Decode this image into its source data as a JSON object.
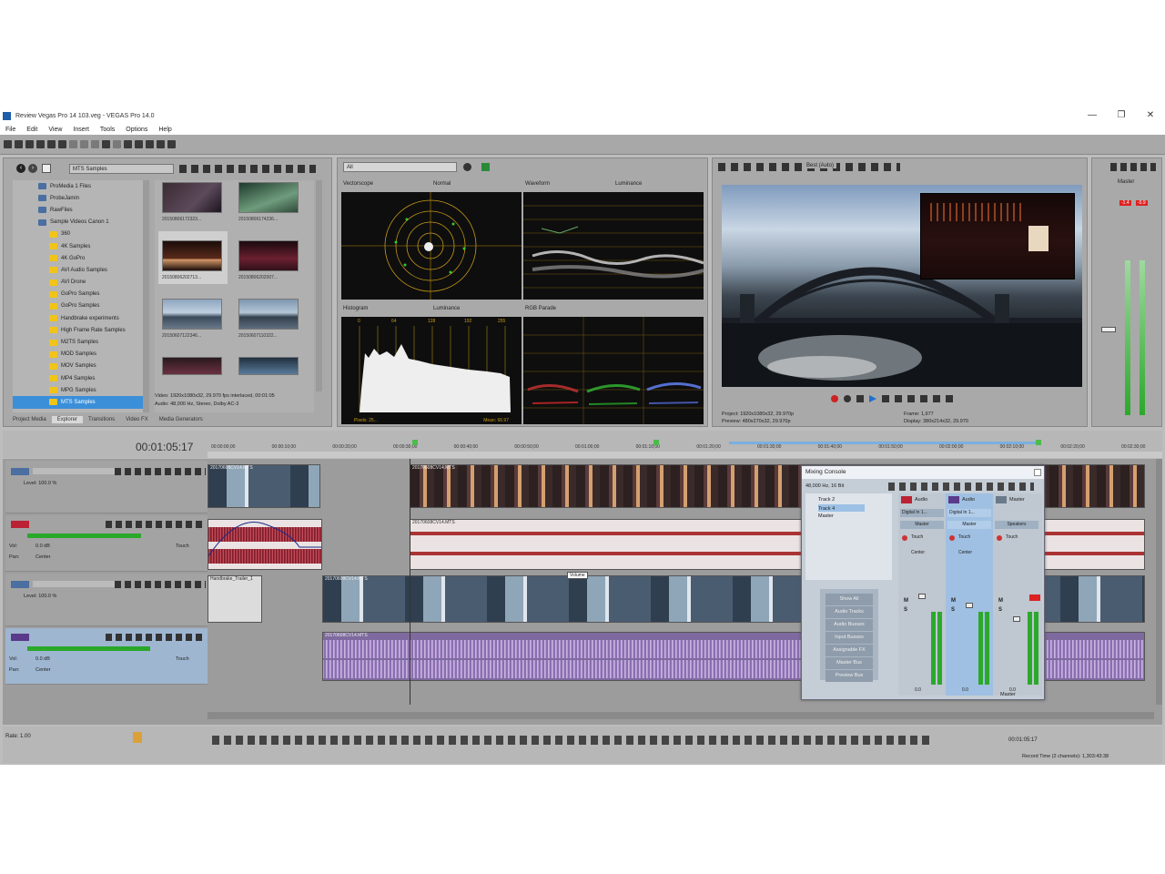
{
  "window": {
    "title": "Review Vegas Pro 14 103.veg - VEGAS Pro 14.0",
    "controls": [
      "—",
      "❐",
      "✕"
    ]
  },
  "menu": [
    "File",
    "Edit",
    "View",
    "Insert",
    "Tools",
    "Options",
    "Help"
  ],
  "explorer": {
    "path": "MTS Samples",
    "tree": [
      {
        "label": "ProMedia 1 Files",
        "folder": false
      },
      {
        "label": "ProbeJamin",
        "folder": false
      },
      {
        "label": "RawFiles",
        "folder": false
      },
      {
        "label": "Sample Videos Canon 1",
        "folder": false
      },
      {
        "label": "360",
        "folder": true
      },
      {
        "label": "4K Samples",
        "folder": true
      },
      {
        "label": "4K GoPro",
        "folder": true
      },
      {
        "label": "AVI Audio Samples",
        "folder": true
      },
      {
        "label": "AVI Drone",
        "folder": true
      },
      {
        "label": "GoPro Samples",
        "folder": true
      },
      {
        "label": "GoPro Samples",
        "folder": true
      },
      {
        "label": "Handbrake experiments",
        "folder": true
      },
      {
        "label": "High Frame Rate Samples",
        "folder": true
      },
      {
        "label": "M2TS Samples",
        "folder": true
      },
      {
        "label": "MOD Samples",
        "folder": true
      },
      {
        "label": "MOV Samples",
        "folder": true
      },
      {
        "label": "MP4 Samples",
        "folder": true
      },
      {
        "label": "MPG Samples",
        "folder": true
      },
      {
        "label": "MTS Samples",
        "folder": true,
        "selected": true
      }
    ],
    "thumbs": [
      "20150806172323...",
      "20150806174236...",
      "20150806202713...",
      "20150806202007...",
      "20150607122346...",
      "20150607110322...",
      "",
      ""
    ],
    "status_line1": "Video: 1920x1080x32, 29.970 fps interlaced, 00:01:05",
    "status_line2": "Audio: 48,000 Hz, Stereo, Dolby AC-3",
    "tabs": [
      "Project Media",
      "Explorer",
      "Transitions",
      "Video FX",
      "Media Generators"
    ],
    "active_tab": "Explorer"
  },
  "scopes": {
    "dropdown": "All",
    "vectorscope": {
      "title": "Vectorscope",
      "mode": "Normal"
    },
    "waveform": {
      "title": "Waveform",
      "mode": "Luminance"
    },
    "histogram": {
      "title": "Histogram",
      "mode": "Luminance",
      "footer_left": "Pixels: 25...",
      "footer_right": "Mean: 66.97"
    },
    "rgb_parade": {
      "title": "RGB Parade"
    },
    "histogram_ticks": [
      "0",
      "64",
      "128",
      "192",
      "255"
    ]
  },
  "preview": {
    "quality": "Best (Auto)",
    "project_label": "Project:",
    "project_value": "1920x1080x32, 29.970p",
    "preview_label": "Preview:",
    "preview_value": "480x270x32, 29.970p",
    "frame_label": "Frame:",
    "frame_value": "1,977",
    "display_label": "Display:",
    "display_value": "380x214x32, 29.970"
  },
  "master_meter": {
    "label": "Master",
    "peak_left": "-1.4",
    "peak_right": "-0.9"
  },
  "timeline": {
    "timecode": "00:01:05:17",
    "rate": "Rate: 1.00",
    "record_time": "Record Time (2 channels): 1,303:43:38",
    "end_time": "00:01:05:17",
    "ruler": [
      "00:00:00;00",
      "00:00:10;00",
      "00:00:20;00",
      "00:00:30;00",
      "00:00:40;00",
      "00:00:50;00",
      "00:01:00;00",
      "00:01:10;00",
      "00:01:20;00",
      "00:01:30;00",
      "00:01:40;00",
      "00:01:50;00",
      "00:02:00;00",
      "00:02:10;00",
      "00:02:20;00",
      "00:02:30;00"
    ],
    "tracks": [
      {
        "type": "video",
        "level": "Level: 100.0 %"
      },
      {
        "type": "audio",
        "vol": "Vol:",
        "vol_value": "0.0 dB",
        "pan": "Pan:",
        "pan_value": "Center",
        "touch": "Touch"
      },
      {
        "type": "video",
        "level": "Level: 100.0 %"
      },
      {
        "type": "audio",
        "vol": "Vol:",
        "vol_value": "0.0 dB",
        "pan": "Pan:",
        "pan_value": "Center",
        "touch": "Touch"
      }
    ],
    "clips": [
      "20170608CV14.MTS",
      "20170608CV14.MTS",
      "20170608CV14.MTS",
      "20170608CV14.MTS",
      "Handbrake_Trailer_1",
      "20170608CV14.MTS",
      "20170608CV14.MTS"
    ],
    "tooltip": "Volume"
  },
  "mixer": {
    "title": "Mixing Console",
    "channels_label": "48,000 Hz, 16 Bit",
    "tree": [
      "Track 2",
      "Track 4",
      "Master"
    ],
    "view_buttons": [
      "Show All",
      "Audio Tracks",
      "Audio Busses",
      "Input Busses",
      "Assignable FX",
      "Master Bus",
      "Preview Bus"
    ],
    "strips": [
      {
        "name": "Audio",
        "input": "Digital In 1...",
        "output": "Master",
        "mode": "Touch",
        "pan": "Center",
        "db": "0.0"
      },
      {
        "name": "Audio",
        "input": "Digital In 1...",
        "output": "Master",
        "mode": "Touch",
        "pan": "Center",
        "db": "0.0"
      },
      {
        "name": "Master",
        "input": "",
        "output": "Speakers",
        "mode": "Touch",
        "pan": "",
        "db": "0.0"
      }
    ],
    "master_label": "Master"
  }
}
